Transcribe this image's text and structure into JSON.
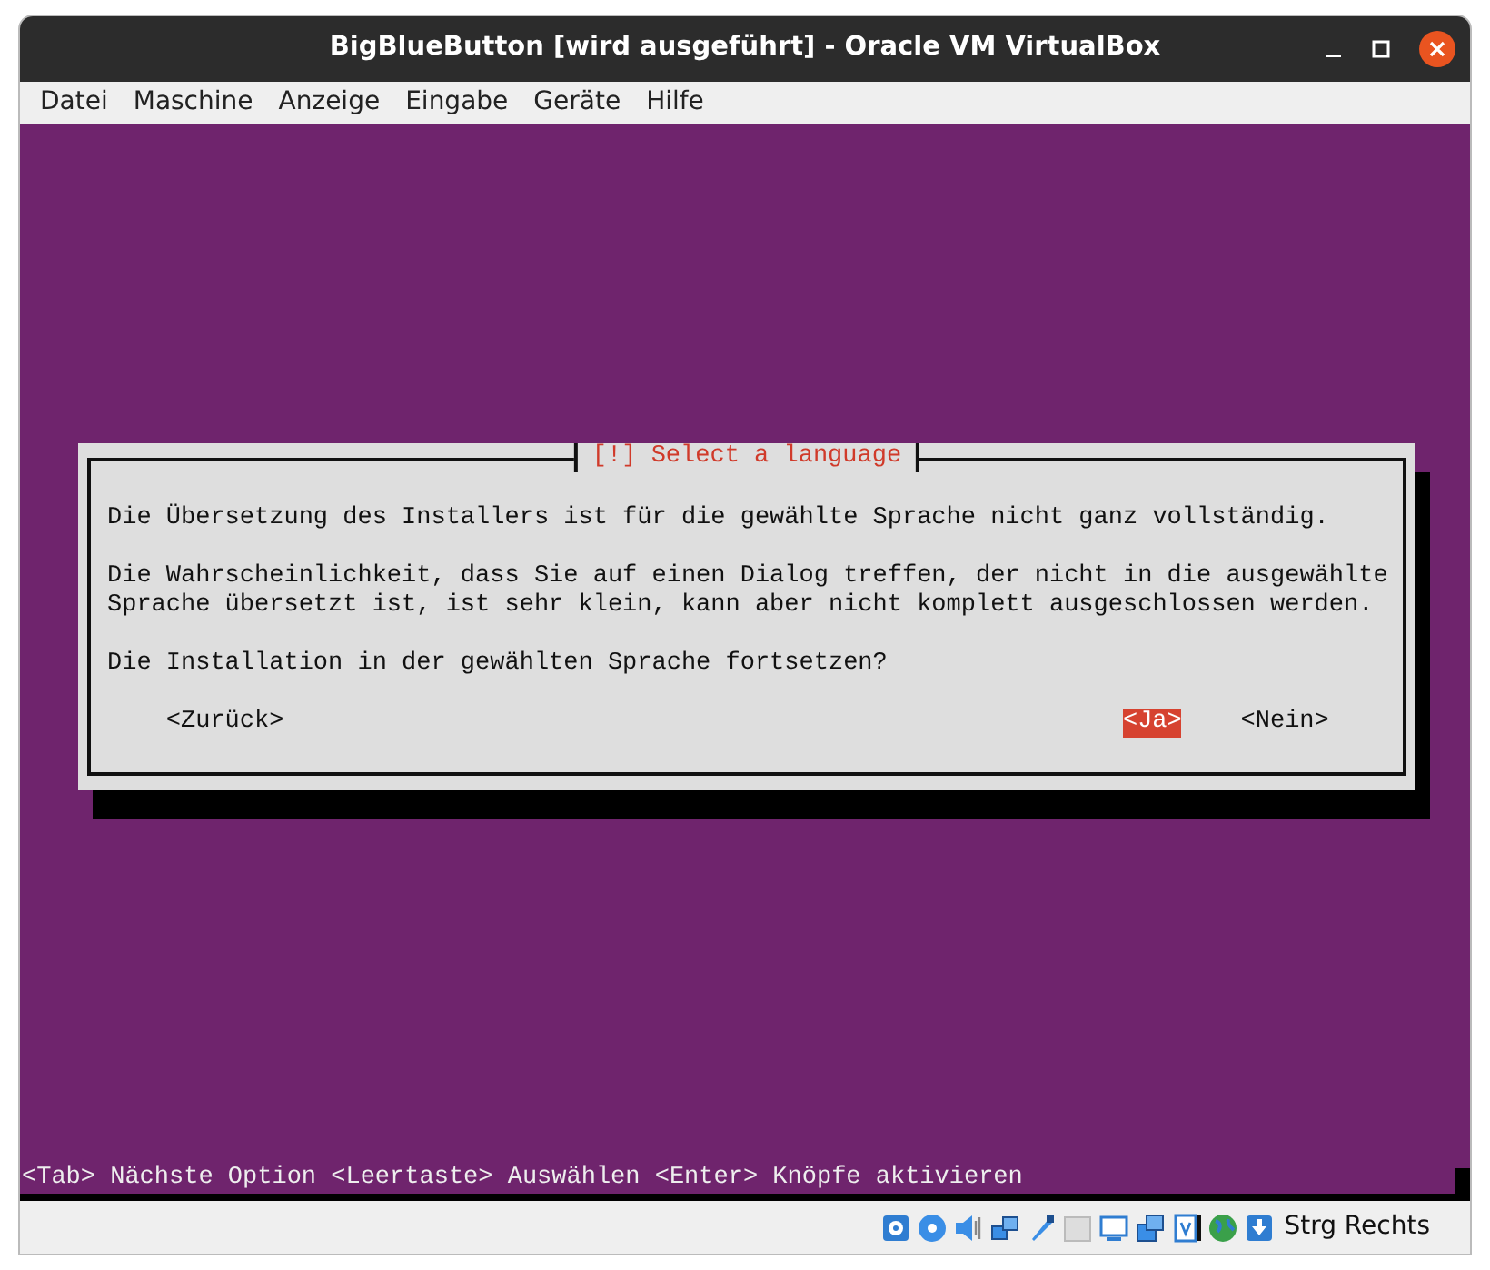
{
  "window": {
    "title": "BigBlueButton [wird ausgeführt] - Oracle VM VirtualBox"
  },
  "menu": [
    "Datei",
    "Maschine",
    "Anzeige",
    "Eingabe",
    "Geräte",
    "Hilfe"
  ],
  "dialog": {
    "title": "[!] Select a language",
    "paragraphs": [
      [
        "Die Übersetzung des Installers ist für die gewählte Sprache nicht ganz vollständig."
      ],
      [
        "Die Wahrscheinlichkeit, dass Sie auf einen Dialog treffen, der nicht in die ausgewählte",
        "Sprache übersetzt ist, ist sehr klein, kann aber nicht komplett ausgeschlossen werden."
      ],
      [
        "Die Installation in der gewählten Sprache fortsetzen?"
      ]
    ],
    "buttons": [
      {
        "label": "<Zurück>",
        "selected": false
      },
      {
        "label": "<Ja>",
        "selected": true
      },
      {
        "label": "<Nein>",
        "selected": false
      }
    ]
  },
  "help_line": "<Tab> Nächste Option <Leertaste> Auswählen <Enter> Knöpfe aktivieren",
  "status_bar": {
    "host_key": "Strg Rechts"
  }
}
